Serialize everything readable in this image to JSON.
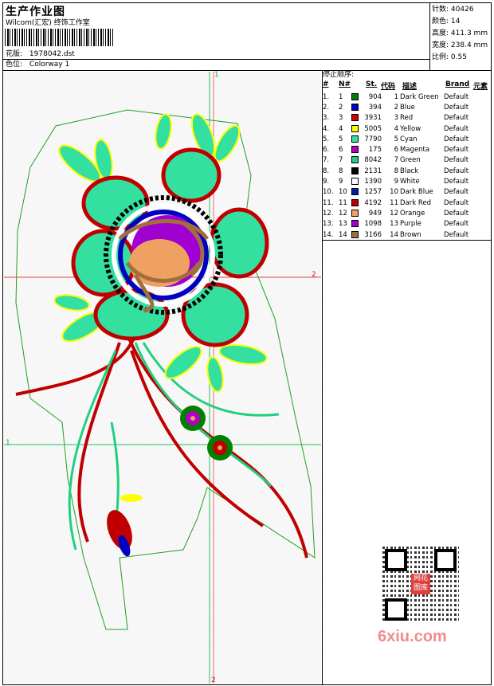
{
  "header": {
    "title": "生产作业图",
    "company": "Wilcom(汇宏) 终饰工作室",
    "pattern_label": "花版:",
    "pattern_value": "1978042.dst",
    "colorway_label": "色位:",
    "colorway_value": "Colorway 1"
  },
  "stats": [
    {
      "label": "针数:",
      "value": "40426"
    },
    {
      "label": "颜色:",
      "value": "14"
    },
    {
      "label": "高度:",
      "value": "411.3 mm"
    },
    {
      "label": "宽度:",
      "value": "238.4 mm"
    },
    {
      "label": "比例:",
      "value": "0.55"
    }
  ],
  "stop_sequence": {
    "title": "停止顺序:",
    "columns": [
      "#",
      "N#",
      "St.",
      "代码",
      "描述",
      "Brand",
      "元素"
    ],
    "rows": [
      {
        "idx": "1.",
        "n": "1",
        "st": "904",
        "code": "1",
        "desc": "Dark Green",
        "brand": "Default",
        "color": "#008000"
      },
      {
        "idx": "2.",
        "n": "2",
        "st": "394",
        "code": "2",
        "desc": "Blue",
        "brand": "Default",
        "color": "#0000c0"
      },
      {
        "idx": "3.",
        "n": "3",
        "st": "3931",
        "code": "3",
        "desc": "Red",
        "brand": "Default",
        "color": "#d00000"
      },
      {
        "idx": "4.",
        "n": "4",
        "st": "5005",
        "code": "4",
        "desc": "Yellow",
        "brand": "Default",
        "color": "#ffff00"
      },
      {
        "idx": "5.",
        "n": "5",
        "st": "7790",
        "code": "5",
        "desc": "Cyan",
        "brand": "Default",
        "color": "#33e0a0"
      },
      {
        "idx": "6.",
        "n": "6",
        "st": "175",
        "code": "6",
        "desc": "Magenta",
        "brand": "Default",
        "color": "#b000c0"
      },
      {
        "idx": "7.",
        "n": "7",
        "st": "8042",
        "code": "7",
        "desc": "Green",
        "brand": "Default",
        "color": "#20d080"
      },
      {
        "idx": "8.",
        "n": "8",
        "st": "2131",
        "code": "8",
        "desc": "Black",
        "brand": "Default",
        "color": "#000000"
      },
      {
        "idx": "9.",
        "n": "9",
        "st": "1390",
        "code": "9",
        "desc": "White",
        "brand": "Default",
        "color": "#ffffff"
      },
      {
        "idx": "10.",
        "n": "10",
        "st": "1257",
        "code": "10",
        "desc": "Dark Blue",
        "brand": "Default",
        "color": "#0020a0"
      },
      {
        "idx": "11.",
        "n": "11",
        "st": "4192",
        "code": "11",
        "desc": "Dark Red",
        "brand": "Default",
        "color": "#c00000"
      },
      {
        "idx": "12.",
        "n": "12",
        "st": "949",
        "code": "12",
        "desc": "Orange",
        "brand": "Default",
        "color": "#f0a060"
      },
      {
        "idx": "13.",
        "n": "13",
        "st": "1098",
        "code": "13",
        "desc": "Purple",
        "brand": "Default",
        "color": "#a000d0"
      },
      {
        "idx": "14.",
        "n": "14",
        "st": "3166",
        "code": "14",
        "desc": "Brown",
        "brand": "Default",
        "color": "#a0703c"
      }
    ]
  },
  "guides": {
    "top": "1",
    "right": "2",
    "left": "1",
    "bottom": "2"
  },
  "watermark": {
    "text": "6xiu.com",
    "seal": "网花图库"
  }
}
